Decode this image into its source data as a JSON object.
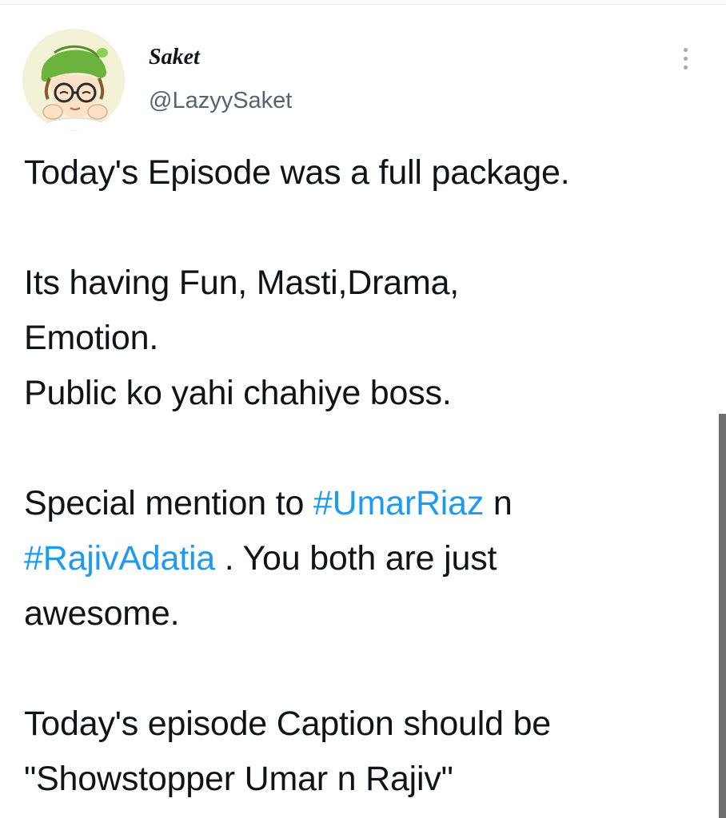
{
  "tweet": {
    "author": {
      "display_name": "Saket",
      "handle": "@LazyySaket"
    },
    "menu_icon": "more-vertical-icon",
    "body": {
      "line1": "Today's Episode was a full package.",
      "line2": "Its having Fun, Masti,Drama,",
      "line3": "Emotion.",
      "line4": "Public ko yahi chahiye boss.",
      "line5_prefix": "Special mention to ",
      "hashtag1": "#UmarRiaz",
      "line5_suffix": " n",
      "hashtag2": "#RajivAdatia",
      "line6_suffix": " . You both are just",
      "line7": "awesome.",
      "line8": "Today's episode Caption should be",
      "line9": "\"Showstopper Umar n Rajiv\""
    }
  },
  "colors": {
    "text": "#0f1419",
    "secondary": "#536471",
    "hashtag": "#1d9bf0",
    "avatar_bg": "#f3f1d6"
  }
}
